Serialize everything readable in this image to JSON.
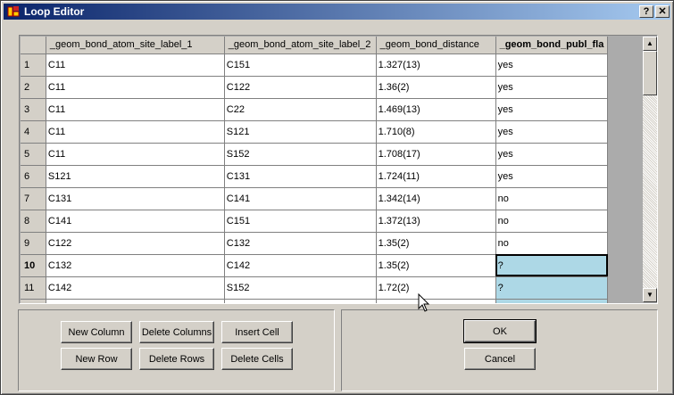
{
  "window": {
    "title": "Loop Editor",
    "help_label": "?",
    "close_label": "✕"
  },
  "grid": {
    "columns": [
      "_geom_bond_atom_site_label_1",
      "_geom_bond_atom_site_label_2",
      "_geom_bond_distance",
      "_geom_bond_publ_fla"
    ],
    "rows": [
      {
        "num": "1",
        "cells": [
          "C11",
          "C151",
          "1.327(13)",
          "yes"
        ]
      },
      {
        "num": "2",
        "cells": [
          "C11",
          "C122",
          "1.36(2)",
          "yes"
        ]
      },
      {
        "num": "3",
        "cells": [
          "C11",
          "C22",
          "1.469(13)",
          "yes"
        ]
      },
      {
        "num": "4",
        "cells": [
          "C11",
          "S121",
          "1.710(8)",
          "yes"
        ]
      },
      {
        "num": "5",
        "cells": [
          "C11",
          "S152",
          "1.708(17)",
          "yes"
        ]
      },
      {
        "num": "6",
        "cells": [
          "S121",
          "C131",
          "1.724(11)",
          "yes"
        ]
      },
      {
        "num": "7",
        "cells": [
          "C131",
          "C141",
          "1.342(14)",
          "no"
        ]
      },
      {
        "num": "8",
        "cells": [
          "C141",
          "C151",
          "1.372(13)",
          "no"
        ]
      },
      {
        "num": "9",
        "cells": [
          "C122",
          "C132",
          "1.35(2)",
          "no"
        ]
      },
      {
        "num": "10",
        "cells": [
          "C132",
          "C142",
          "1.35(2)",
          "?"
        ]
      },
      {
        "num": "11",
        "cells": [
          "C142",
          "S152",
          "1.72(2)",
          "?"
        ]
      },
      {
        "num": "",
        "cells": [
          "",
          "",
          "",
          ""
        ]
      }
    ],
    "active_row": 9,
    "active_col": 3
  },
  "buttons": {
    "new_column": "New Column",
    "delete_columns": "Delete Columns",
    "insert_cell": "Insert Cell",
    "new_row": "New Row",
    "delete_rows": "Delete Rows",
    "delete_cells": "Delete Cells",
    "ok": "OK",
    "cancel": "Cancel"
  },
  "colors": {
    "selection": "#add8e6",
    "titlebar_start": "#0a246a",
    "titlebar_end": "#a6caf0",
    "face": "#d4d0c8"
  }
}
